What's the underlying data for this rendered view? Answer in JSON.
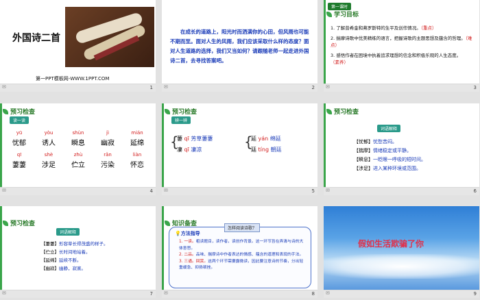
{
  "s1": {
    "title": "外国诗二首",
    "footer": "第一PPT模板网-WWW.1PPT.COM",
    "num": "1"
  },
  "s2": {
    "text": "在成长的道路上，阳光时而洒满你的心田，但风雨也可能不期而至。面对人生的风雨，我们应该采取什么样的态度？面对人生道路的选择，我们又当如何？请跟随老师一起走进外国诗二首，去寻找答案吧。",
    "num": "2"
  },
  "s3": {
    "tab": "第一课时",
    "heading": "学习目标",
    "items": [
      {
        "t": "1. 了解普希金和弗罗斯特的生平及创作情况。",
        "m": "（重点）"
      },
      {
        "t": "2. 揣摩诗歌中优美精练的语言，把握诗歌的主题思想及蕴含的哲理。",
        "m": "（难点）"
      },
      {
        "t": "3. 感悟作者在困境中执着追求理想的信念和积极乐观的人生态度。",
        "m": "（素养）"
      }
    ],
    "num": "3"
  },
  "s4": {
    "heading": "预习检查",
    "tag": "读一读",
    "row1": [
      {
        "py": "yū",
        "hz": "忧郁"
      },
      {
        "py": "yòu",
        "hz": "诱人"
      },
      {
        "py": "shùn",
        "hz": "瞬息"
      },
      {
        "py": "jì",
        "hz": "幽寂"
      },
      {
        "py": "mián",
        "hz": "延绵"
      }
    ],
    "row2": [
      {
        "py": "qī",
        "hz": "萋萋"
      },
      {
        "py": "shè",
        "hz": "涉足"
      },
      {
        "py": "zhù",
        "hz": "伫立"
      },
      {
        "py": "rǎn",
        "hz": "污染"
      },
      {
        "py": "liàn",
        "hz": "怀恋"
      }
    ],
    "num": "4"
  },
  "s5": {
    "heading": "预习检查",
    "tag": "辨一辨",
    "a1": "萋",
    "a1py": "qī",
    "a1w": "芳草萋萋",
    "a2": "凄",
    "a2py": "qī",
    "a2w": "凄凉",
    "b1": "延",
    "b1py": "yán",
    "b1w": "绵延",
    "b2": "廷",
    "b2py": "tíng",
    "b2w": "朝廷",
    "num": "5"
  },
  "s6": {
    "heading": "预习检查",
    "tag": "词语解释",
    "items": [
      {
        "k": "【忧郁】",
        "v": "忧愁苦闷。"
      },
      {
        "k": "【揣摩】",
        "v": "情绪稳定或平静。"
      },
      {
        "k": "【瞬息】",
        "v": "一眨眼一呼吸的短时间。"
      },
      {
        "k": "【涉足】",
        "v": "进入某种环境或范围。"
      }
    ],
    "num": "6"
  },
  "s7": {
    "heading": "预习检查",
    "tag": "词语解释",
    "items": [
      {
        "k": "【萋萋】",
        "v": "形容草长得茂盛的样子。"
      },
      {
        "k": "【伫立】",
        "v": "长时间地站着。"
      },
      {
        "k": "【延绵】",
        "v": "延续不断。"
      },
      {
        "k": "【幽寂】",
        "v": "幽静，寂寞。"
      }
    ],
    "num": "7"
  },
  "s8": {
    "heading": "知识备查",
    "box_title": "怎样阅读诗歌？",
    "label": "方法指导",
    "items": [
      {
        "n": "1. 一读。",
        "t": "粗读题目，读作者，读创作背景。这一环节旨在弄清与诗的大体意思。"
      },
      {
        "n": "2. 二品。",
        "t": "品味、揣摩诗中作者表达的情感、蕴含的道理和表现的手法。"
      },
      {
        "n": "3. 三诵。回赏。",
        "t": "这两个环节需要露微读，因此要注意诗的节奏，分出轻重缓急、抑扬顿挫。"
      }
    ],
    "num": "8"
  },
  "s9": {
    "title": "假如生活欺骗了你",
    "num": "9"
  }
}
